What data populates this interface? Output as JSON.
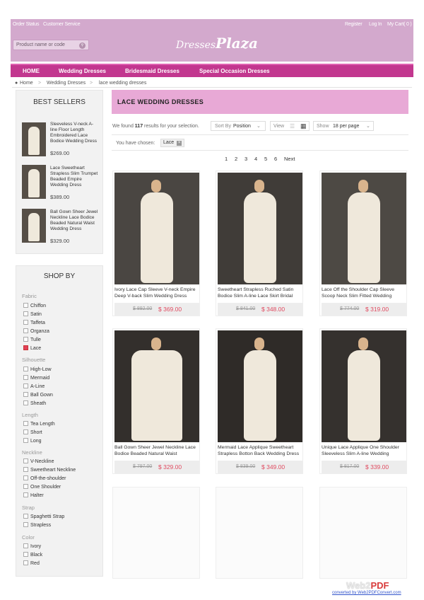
{
  "header": {
    "order_status": "Order Status",
    "customer_service": "Customer Service",
    "register": "Register",
    "login": "Log In",
    "cart": "My Cart( 0 )",
    "search_placeholder": "Product name or code",
    "logo_part1": "Dresses",
    "logo_part2": "Plaza"
  },
  "nav": [
    "HOME",
    "Wedding Dresses",
    "Bridesmaid Dresses",
    "Special Occasion Dresses"
  ],
  "breadcrumb": [
    "Home",
    ">",
    "Wedding Dresses",
    ">",
    "lace wedding dresses"
  ],
  "best_sellers": {
    "title": "BEST SELLERS",
    "items": [
      {
        "name": "Sleeveless V-neck A-line Floor Length Embroidered Lace Bodice Wedding Dress",
        "price": "$269.00"
      },
      {
        "name": "Lace Sweetheart Strapless Slim Trumpet Beaded Empire Wedding Dress",
        "price": "$389.00"
      },
      {
        "name": "Ball Gown Sheer Jewel Neckline Lace Bodice Beaded Natural Waist Wedding Dress",
        "price": "$329.00"
      }
    ]
  },
  "shop_by": {
    "title": "SHOP BY",
    "groups": [
      {
        "label": "Fabric",
        "options": [
          "Chiffon",
          "Satin",
          "Taffeta",
          "Organza",
          "Tulle",
          "Lace"
        ]
      },
      {
        "label": "Silhouette",
        "options": [
          "High-Low",
          "Mermaid",
          "A-Line",
          "Ball Gown",
          "Sheath"
        ]
      },
      {
        "label": "Length",
        "options": [
          "Tea Length",
          "Short",
          "Long"
        ]
      },
      {
        "label": "Neckline",
        "options": [
          "V-Neckline",
          "Sweetheart Neckline",
          "Off-the-shoulder",
          "One Shoulder",
          "Halter"
        ]
      },
      {
        "label": "Strap",
        "options": [
          "Spaghetti Strap",
          "Strapless"
        ]
      },
      {
        "label": "Color",
        "options": [
          "Ivory",
          "Black",
          "Red"
        ]
      }
    ],
    "checked": "Lace"
  },
  "category": {
    "title": "LACE WEDDING DRESSES",
    "found_prefix": "We found",
    "found_count": "117",
    "found_suffix": "results for your selection.",
    "sort_label": "Sort By",
    "sort_value": "Position",
    "view_label": "View",
    "show_label": "Show",
    "show_value": "18 per page",
    "chosen_label": "You have chosen:",
    "chosen_value": "Lace"
  },
  "pagination": [
    "1",
    "2",
    "3",
    "4",
    "5",
    "6",
    "Next"
  ],
  "products": [
    {
      "name": "Ivory Lace Cap Sleeve V-neck Empire Deep V-back Slim Wedding Dress",
      "old": "$ 892.00",
      "price": "$ 369.00"
    },
    {
      "name": "Sweetheart Strapless Ruched Satin Bodice Slim A-line Lace Skirt Bridal",
      "old": "$ 841.00",
      "price": "$ 348.00"
    },
    {
      "name": "Lace Off the Shoulder Cap Sleeve Scoop Neck Slim Fitted Wedding",
      "old": "$ 774.00",
      "price": "$ 319.00"
    },
    {
      "name": "Ball Gown Sheer Jewel Neckline Lace Bodice Beaded Natural Waist",
      "old": "$ 797.00",
      "price": "$ 329.00"
    },
    {
      "name": "Mermaid Lace Applique Sweetheart Strapless Botton Back Wedding Dress",
      "old": "$ 839.00",
      "price": "$ 349.00"
    },
    {
      "name": "Unique Lace Applique One Shoulder Sleeveless Slim A-line Wedding",
      "old": "$ 817.00",
      "price": "$ 339.00"
    }
  ],
  "watermark": {
    "brand_a": "Web2",
    "brand_b": "PDF",
    "sub": "converted by Web2PDFConvert.com"
  },
  "colors": {
    "header_bg": "#d3a9cd",
    "nav_bg": "#c2378f",
    "category_bg": "#e8a9d6",
    "price_red": "#e04b60"
  }
}
